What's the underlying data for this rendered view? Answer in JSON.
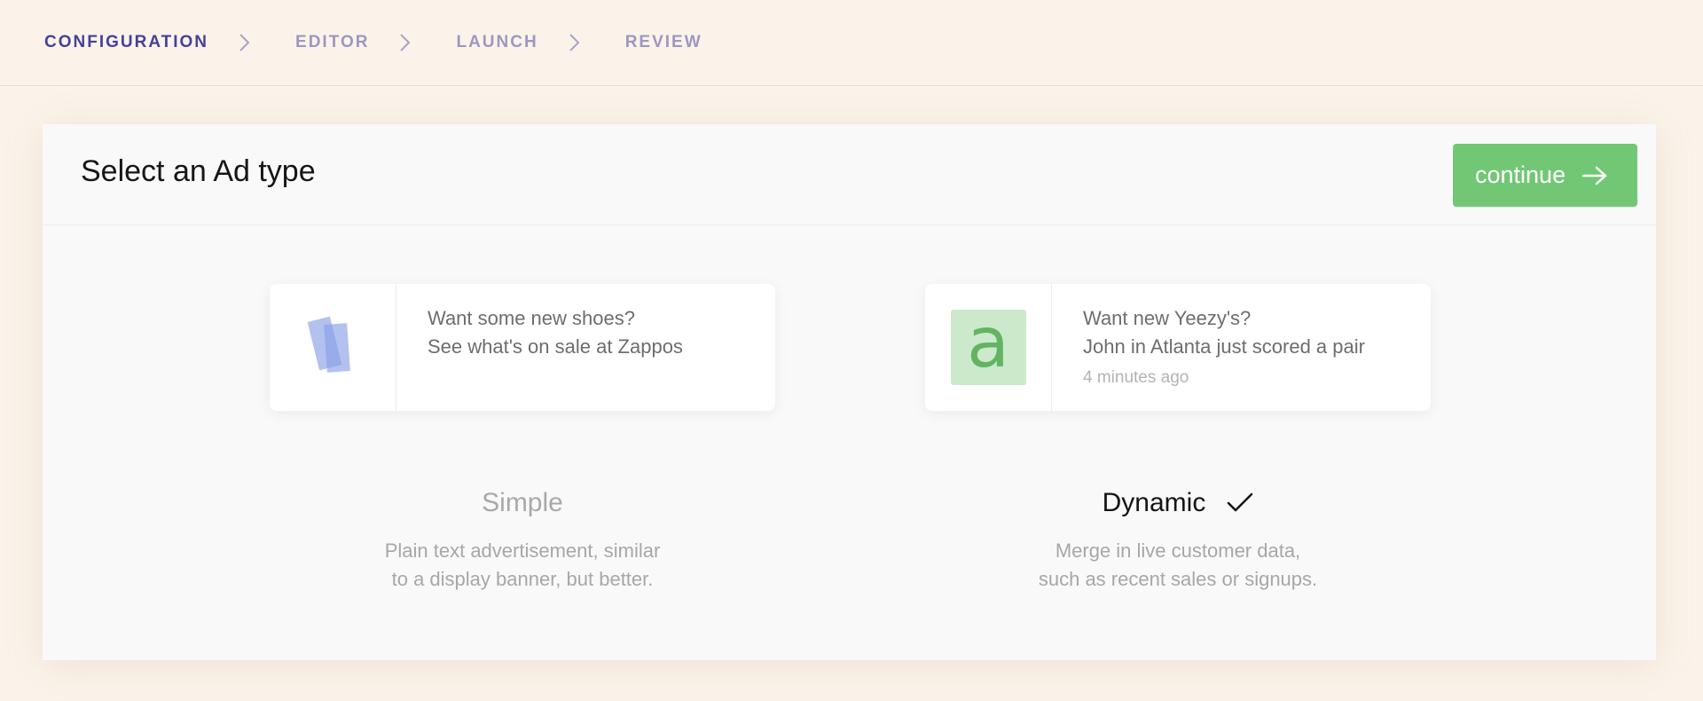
{
  "stepper": {
    "steps": [
      {
        "label": "CONFIGURATION",
        "active": true
      },
      {
        "label": "EDITOR",
        "active": false
      },
      {
        "label": "LAUNCH",
        "active": false
      },
      {
        "label": "REVIEW",
        "active": false
      }
    ],
    "separator_icon": "chevron-right-icon"
  },
  "panel": {
    "title": "Select an Ad type",
    "continue_label": "continue",
    "continue_icon": "arrow-right-icon"
  },
  "options": {
    "simple": {
      "preview_line1": "Want some new shoes?",
      "preview_line2": "See what's on sale at Zappos",
      "thumb_icon": "overlapping-rectangles-icon",
      "title": "Simple",
      "desc_line1": "Plain text advertisement, similar",
      "desc_line2": "to a display banner, but better.",
      "selected": false
    },
    "dynamic": {
      "preview_line1": "Want new Yeezy's?",
      "preview_line2": "John in Atlanta just scored a pair",
      "preview_time": "4 minutes ago",
      "thumb_letter": "a",
      "title": "Dynamic",
      "desc_line1": "Merge in live customer data,",
      "desc_line2": "such as recent sales or signups.",
      "selected": true,
      "selected_icon": "checkmark-icon"
    }
  },
  "colors": {
    "page_bg": "#fbf3ea",
    "step_active": "#45419a",
    "step_inactive": "#9d97c0",
    "continue_bg": "#72c775",
    "thumb_blue": "#8a9fe6",
    "tile_green_bg": "#cce9cc",
    "tile_green_fg": "#62b462"
  }
}
